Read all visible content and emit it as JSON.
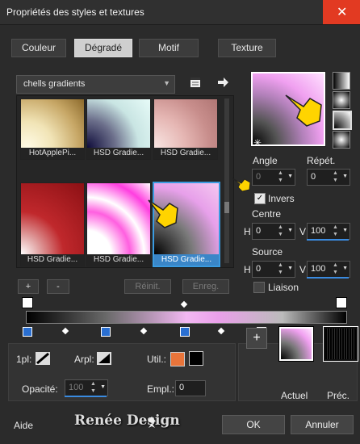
{
  "window": {
    "title": "Propriétés des styles et textures",
    "close_glyph": "✕"
  },
  "tabs": [
    {
      "label": "Couleur"
    },
    {
      "label": "Dégradé"
    },
    {
      "label": "Motif"
    },
    {
      "label": "Texture"
    }
  ],
  "gradient_combo": {
    "value": "chells gradients"
  },
  "thumbnails": [
    {
      "label": "HotApplePi..."
    },
    {
      "label": "HSD Gradie..."
    },
    {
      "label": "HSD Gradie..."
    },
    {
      "label": "HSD Gradie..."
    },
    {
      "label": "HSD Gradie..."
    },
    {
      "label": "HSD Gradie..."
    }
  ],
  "list_buttons": {
    "add": "+",
    "remove": "-",
    "reset": "Réinit.",
    "save": "Enreg."
  },
  "props": {
    "angle_label": "Angle",
    "angle_value": "0",
    "repeat_label": "Répét.",
    "repeat_value": "0",
    "invert_label": "Invers",
    "invert_checked": "✓",
    "center_label": "Centre",
    "center_h_label": "H",
    "center_h_value": "0",
    "center_v_label": "V",
    "center_v_value": "100",
    "source_label": "Source",
    "source_h_label": "H",
    "source_h_value": "0",
    "source_v_label": "V",
    "source_v_value": "100",
    "link_label": "Liaison"
  },
  "bottom": {
    "pl_label": "1pl:",
    "arpl_label": "Arpl:",
    "util_label": "Util.:",
    "opacity_label": "Opacité:",
    "opacity_value": "100",
    "empl_label": "Empl.:",
    "empl_value": "0",
    "add_glyph": "+",
    "current_label": "Actuel",
    "prev_label": "Préc."
  },
  "footer": {
    "help": "Aide",
    "watermark": "Renée Design",
    "ok": "OK",
    "cancel": "Annuler"
  },
  "colors": {
    "accent": "#3a8be0",
    "close": "#e23a22",
    "orange_swatch": "#e8743a"
  }
}
